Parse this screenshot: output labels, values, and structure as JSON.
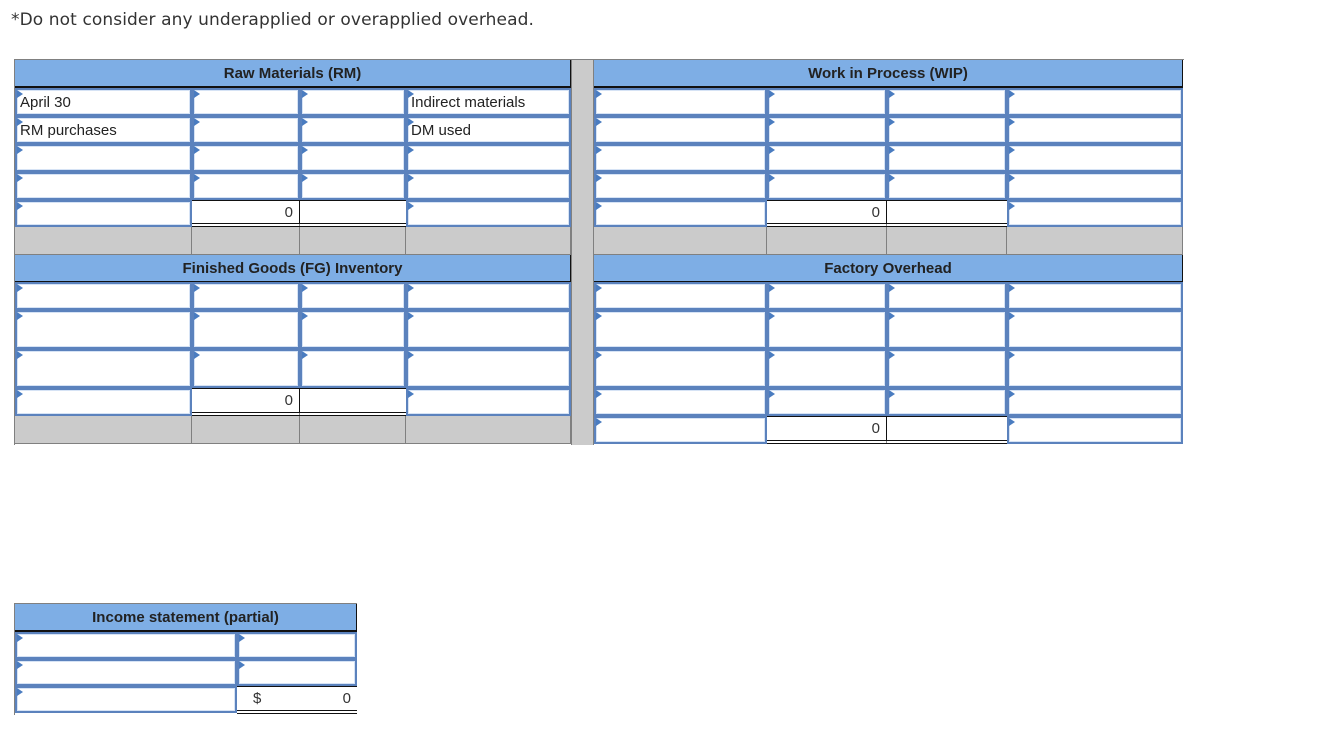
{
  "note": "*Do not consider any underapplied or overapplied overhead.",
  "accounts": {
    "raw_materials": {
      "title": "Raw Materials (RM)",
      "rows": [
        {
          "left_label": "April 30",
          "right_label": "Indirect materials"
        },
        {
          "left_label": "RM purchases",
          "right_label": "DM used"
        },
        {
          "left_label": "",
          "right_label": ""
        },
        {
          "left_label": "",
          "right_label": ""
        }
      ],
      "total": "0"
    },
    "work_in_process": {
      "title": "Work in Process (WIP)",
      "total": "0"
    },
    "finished_goods": {
      "title": "Finished Goods (FG) Inventory",
      "total": "0"
    },
    "factory_overhead": {
      "title": "Factory Overhead",
      "total": "0"
    }
  },
  "income_statement": {
    "title": "Income statement (partial)",
    "currency": "$",
    "total": "0"
  }
}
